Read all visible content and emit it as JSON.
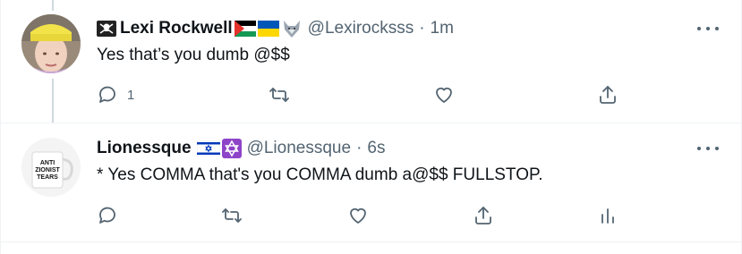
{
  "tweets": [
    {
      "display_name": "Lexi Rockwell",
      "name_emojis": [
        "skull-crossbones-flag",
        "palestine-flag",
        "ukraine-flag",
        "wolf"
      ],
      "handle": "@Lexirocksss",
      "separator": "·",
      "time": "1m",
      "text": "Yes that’s you dumb @$$",
      "reply_count": "1",
      "avatar": "woman-yellow-hat-avatar"
    },
    {
      "display_name": "Lionessque",
      "name_emojis": [
        "israel-flag",
        "star-of-david"
      ],
      "handle": "@Lionessque",
      "separator": "·",
      "time": "6s",
      "text": "* Yes COMMA that's you COMMA dumb a@$$ FULLSTOP.",
      "avatar": "anti-zionist-tears-mug-avatar",
      "avatar_mug_text": [
        "ANTI",
        "ZIONIST",
        "TEARS"
      ]
    }
  ],
  "colors": {
    "text_primary": "#0f1419",
    "text_secondary": "#536471",
    "thread_line": "#cfd9de",
    "border": "#eff3f4"
  },
  "icons": {
    "reply": "reply-icon",
    "retweet": "retweet-icon",
    "like": "heart-icon",
    "share": "share-icon",
    "analytics": "analytics-icon",
    "more": "more-icon"
  }
}
